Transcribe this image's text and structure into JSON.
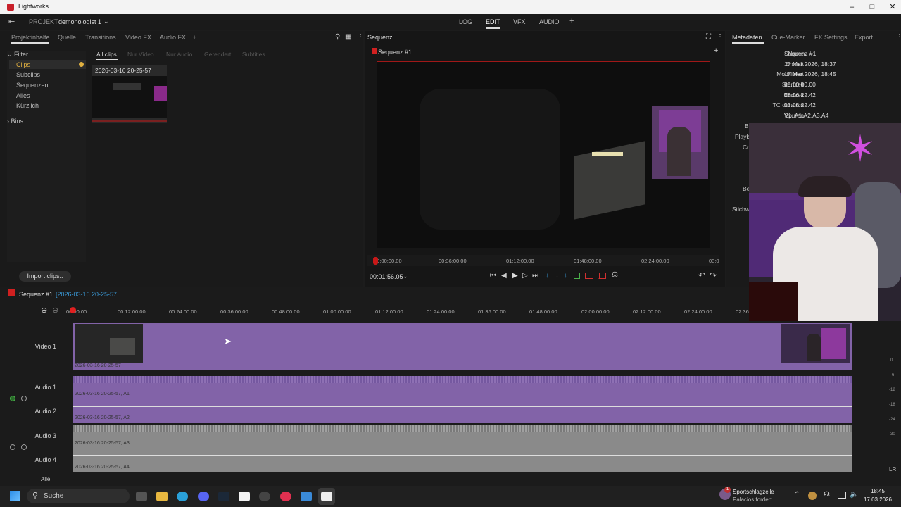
{
  "app": {
    "title": "Lightworks"
  },
  "project": {
    "label": "PROJEKT",
    "name": "demonologist 1"
  },
  "modes": [
    "LOG",
    "EDIT",
    "VFX",
    "AUDIO",
    "+"
  ],
  "active_mode": "EDIT",
  "left": {
    "tabs": [
      "Projektinhalte",
      "Quelle",
      "Transitions",
      "Video FX",
      "Audio FX",
      "+"
    ],
    "filter": "Filter",
    "tree": [
      "Clips",
      "Subclips",
      "Sequenzen",
      "Alles",
      "Kürzlich"
    ],
    "bins": "Bins",
    "subtabs": [
      "All clips",
      "Nur Video",
      "Nur Audio",
      "Gerendert",
      "Subtitles"
    ],
    "clip_name": "2026-03-16 20-25-57",
    "import_btn": "Import clips.."
  },
  "viewer": {
    "title": "Sequenz",
    "seq_name": "Sequenz #1",
    "ruler": [
      "00:00:00.00",
      "00:36:00.00",
      "01:12:00.00",
      "01:48:00.00",
      "02:24:00.00",
      "03:0"
    ],
    "timecode": "00:01:56.05"
  },
  "meta": {
    "tabs": [
      "Metadaten",
      "Cue-Marker",
      "FX Settings",
      "Export"
    ],
    "rows": [
      {
        "k": "Name",
        "v": "Sequenz #1"
      },
      {
        "k": "Erstellt",
        "v": "17 Mar 2026, 18:37"
      },
      {
        "k": "Modifiziert",
        "v": "17 Mar 2026, 18:45"
      },
      {
        "k": "Startzeit",
        "v": "00:00:00.00"
      },
      {
        "k": "Endzeit",
        "v": "03:06:22.42"
      },
      {
        "k": "TC duration",
        "v": "03:06:22.42"
      },
      {
        "k": "Spuren",
        "v": "V1, A1,A2,A3,A4"
      }
    ],
    "partial": [
      "Bi",
      "Playb",
      "Co",
      "Be",
      "Stichw"
    ]
  },
  "timeline": {
    "seq": "Sequenz #1",
    "clip": "[2026-03-16 20-25-57",
    "ticks": [
      "00:00:00",
      "00:12:00.00",
      "00:24:00.00",
      "00:36:00.00",
      "00:48:00.00",
      "01:00:00.00",
      "01:12:00.00",
      "01:24:00.00",
      "01:36:00.00",
      "01:48:00.00",
      "02:00:00.00",
      "02:12:00.00",
      "02:24:00.00",
      "02:36"
    ],
    "tracks": [
      "Video 1",
      "Audio 1",
      "Audio 2",
      "Audio 3",
      "Audio 4"
    ],
    "clip_labels": [
      "2026-03-16 20-25-57",
      "2026-03-16 20-25-57, A1",
      "2026-03-16 20-25-57, A2",
      "2026-03-16 20-25-57, A3",
      "2026-03-16 20-25-57, A4"
    ],
    "alle": "Alle",
    "lr": "LR",
    "meter": [
      "0",
      "-6",
      "-12",
      "-18",
      "-24",
      "-30"
    ]
  },
  "taskbar": {
    "search": "Suche",
    "news_title": "Sportschlagzeile",
    "news_sub": "Palacios fordert...",
    "time": "18:45",
    "date": "17.03.2026",
    "badge": "1"
  }
}
